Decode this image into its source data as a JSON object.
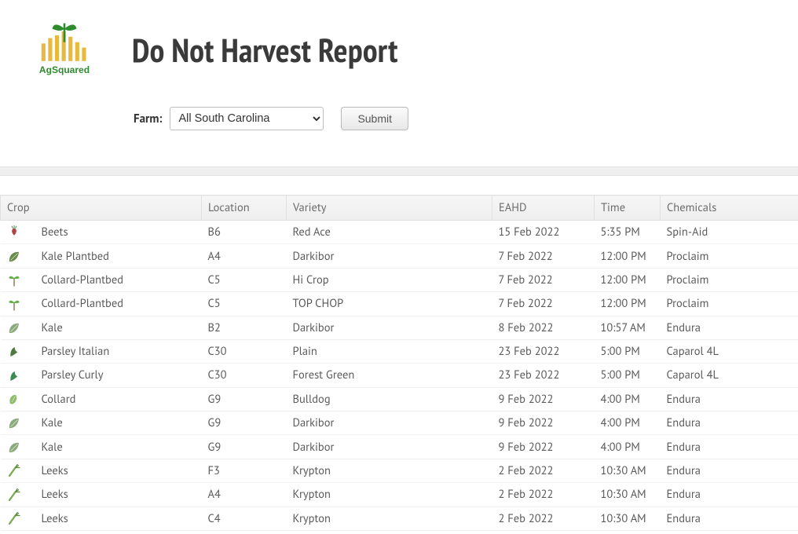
{
  "page": {
    "title": "Do Not Harvest Report",
    "logo_brand_top": "",
    "logo_brand_bottom": "AgSquared"
  },
  "controls": {
    "farm_label": "Farm:",
    "farm_selected": "All South Carolina",
    "farm_options": [
      "All South Carolina"
    ],
    "submit_label": "Submit"
  },
  "table": {
    "columns": {
      "crop": "Crop",
      "location": "Location",
      "variety": "Variety",
      "eahd": "EAHD",
      "time": "Time",
      "chemicals": "Chemicals"
    },
    "rows": [
      {
        "icon": "beet",
        "crop": "Beets",
        "location": "B6",
        "variety": "Red Ace",
        "eahd": "15 Feb 2022",
        "time": "5:35 PM",
        "chemicals": "Spin-Aid"
      },
      {
        "icon": "leaf",
        "crop": "Kale Plantbed",
        "location": "A4",
        "variety": "Darkibor",
        "eahd": "7 Feb 2022",
        "time": "12:00 PM",
        "chemicals": "Proclaim"
      },
      {
        "icon": "sprout",
        "crop": "Collard-Plantbed",
        "location": "C5",
        "variety": "Hi Crop",
        "eahd": "7 Feb 2022",
        "time": "12:00 PM",
        "chemicals": "Proclaim"
      },
      {
        "icon": "sprout",
        "crop": "Collard-Plantbed",
        "location": "C5",
        "variety": "TOP CHOP",
        "eahd": "7 Feb 2022",
        "time": "12:00 PM",
        "chemicals": "Proclaim"
      },
      {
        "icon": "kale",
        "crop": "Kale",
        "location": "B2",
        "variety": "Darkibor",
        "eahd": "8 Feb 2022",
        "time": "10:57 AM",
        "chemicals": "Endura"
      },
      {
        "icon": "parsley",
        "crop": "Parsley Italian",
        "location": "C30",
        "variety": "Plain",
        "eahd": "23 Feb 2022",
        "time": "5:00 PM",
        "chemicals": "Caparol 4L"
      },
      {
        "icon": "parsley2",
        "crop": "Parsley Curly",
        "location": "C30",
        "variety": "Forest Green",
        "eahd": "23 Feb 2022",
        "time": "5:00 PM",
        "chemicals": "Caparol 4L"
      },
      {
        "icon": "collard",
        "crop": "Collard",
        "location": "G9",
        "variety": "Bulldog",
        "eahd": "9 Feb 2022",
        "time": "4:00 PM",
        "chemicals": "Endura"
      },
      {
        "icon": "kale",
        "crop": "Kale",
        "location": "G9",
        "variety": "Darkibor",
        "eahd": "9 Feb 2022",
        "time": "4:00 PM",
        "chemicals": "Endura"
      },
      {
        "icon": "kale",
        "crop": "Kale",
        "location": "G9",
        "variety": "Darkibor",
        "eahd": "9 Feb 2022",
        "time": "4:00 PM",
        "chemicals": "Endura"
      },
      {
        "icon": "leek",
        "crop": "Leeks",
        "location": "F3",
        "variety": "Krypton",
        "eahd": "2 Feb 2022",
        "time": "10:30 AM",
        "chemicals": "Endura"
      },
      {
        "icon": "leek",
        "crop": "Leeks",
        "location": "A4",
        "variety": "Krypton",
        "eahd": "2 Feb 2022",
        "time": "10:30 AM",
        "chemicals": "Endura"
      },
      {
        "icon": "leek",
        "crop": "Leeks",
        "location": "C4",
        "variety": "Krypton",
        "eahd": "2 Feb 2022",
        "time": "10:30 AM",
        "chemicals": "Endura"
      }
    ]
  },
  "icon_colors": {
    "beet": "#b04343",
    "leaf": "#6a8a4a",
    "sprout": "#67b24d",
    "kale": "#8aa97c",
    "parsley": "#4e7a3d",
    "parsley2": "#3e8a55",
    "collard": "#8fbb6a",
    "leek": "#7aa84c"
  }
}
